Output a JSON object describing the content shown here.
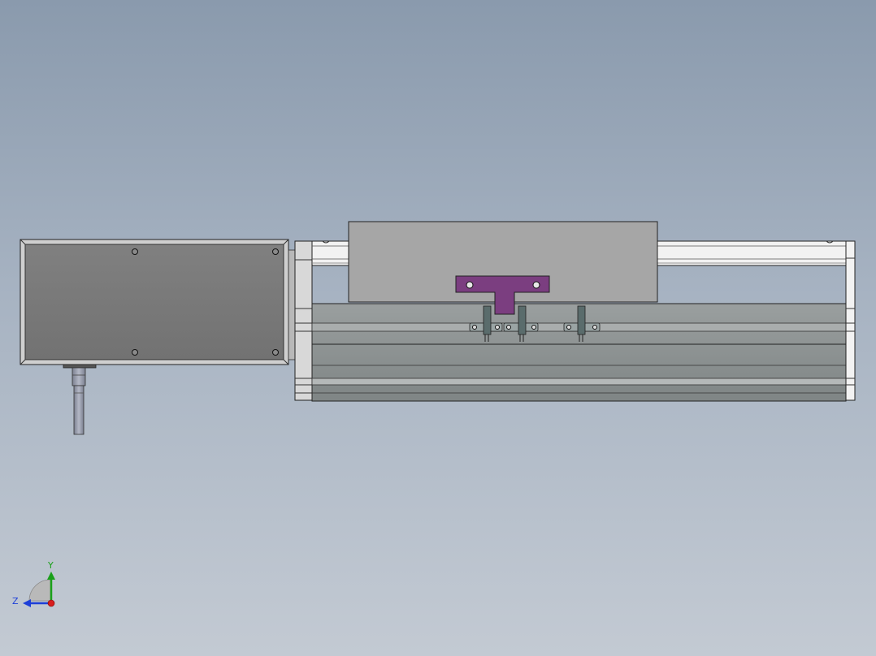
{
  "viewport": {
    "background_top": "#8a9aad",
    "background_bottom": "#c3cad3"
  },
  "model": {
    "motor_housing_color": "#7a7a7a",
    "carriage_color": "#a6a6a6",
    "bracket_color": "#7b3e80",
    "sensor_color": "#5a6c6c",
    "rail_color": "#8c9191"
  },
  "triad": {
    "y_label": "Y",
    "z_label": "Z",
    "y_color": "#1aa01a",
    "z_color": "#1d3fd8",
    "x_color": "#d81d1d"
  }
}
